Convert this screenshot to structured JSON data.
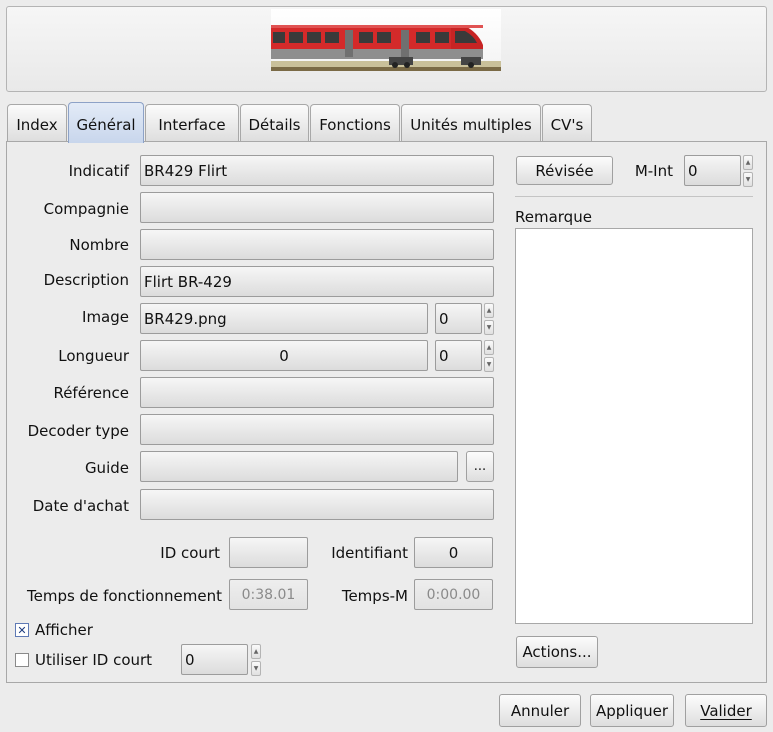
{
  "tabs": [
    {
      "label": "Index",
      "active": false
    },
    {
      "label": "Général",
      "active": true
    },
    {
      "label": "Interface",
      "active": false
    },
    {
      "label": "Détails",
      "active": false
    },
    {
      "label": "Fonctions",
      "active": false
    },
    {
      "label": "Unités multiples",
      "active": false
    },
    {
      "label": "CV's",
      "active": false
    }
  ],
  "form": {
    "indicatif": {
      "label": "Indicatif",
      "value": "BR429 Flirt"
    },
    "compagnie": {
      "label": "Compagnie",
      "value": ""
    },
    "nombre": {
      "label": "Nombre",
      "value": ""
    },
    "description": {
      "label": "Description",
      "value": "Flirt BR-429"
    },
    "image": {
      "label": "Image",
      "value": "BR429.png",
      "index": "0"
    },
    "longueur": {
      "label": "Longueur",
      "value": "0",
      "extra": "0"
    },
    "reference": {
      "label": "Référence",
      "value": ""
    },
    "decoder_type": {
      "label": "Decoder type",
      "value": ""
    },
    "guide": {
      "label": "Guide",
      "value": "",
      "browse_label": "..."
    },
    "date_achat": {
      "label": "Date d'achat",
      "value": ""
    },
    "id_court": {
      "label": "ID court",
      "value": ""
    },
    "identifiant": {
      "label": "Identifiant",
      "value": "0"
    },
    "temps_fonctionnement": {
      "label": "Temps de fonctionnement",
      "value": "0:38.01"
    },
    "temps_m": {
      "label": "Temps-M",
      "value": "0:00.00"
    },
    "afficher": {
      "label": "Afficher",
      "checked": true
    },
    "utiliser_id_court": {
      "label": "Utiliser ID court",
      "checked": false,
      "value": "0"
    }
  },
  "right": {
    "revisee_label": "Révisée",
    "m_int": {
      "label": "M-Int",
      "value": "0"
    },
    "remarque_label": "Remarque",
    "actions_label": "Actions..."
  },
  "footer": {
    "annuler": "Annuler",
    "appliquer": "Appliquer",
    "valider": "Valider"
  },
  "colors": {
    "active_tab": "#c8d6ec",
    "loco_red": "#d42a2a",
    "loco_grey": "#8e8e8e"
  }
}
